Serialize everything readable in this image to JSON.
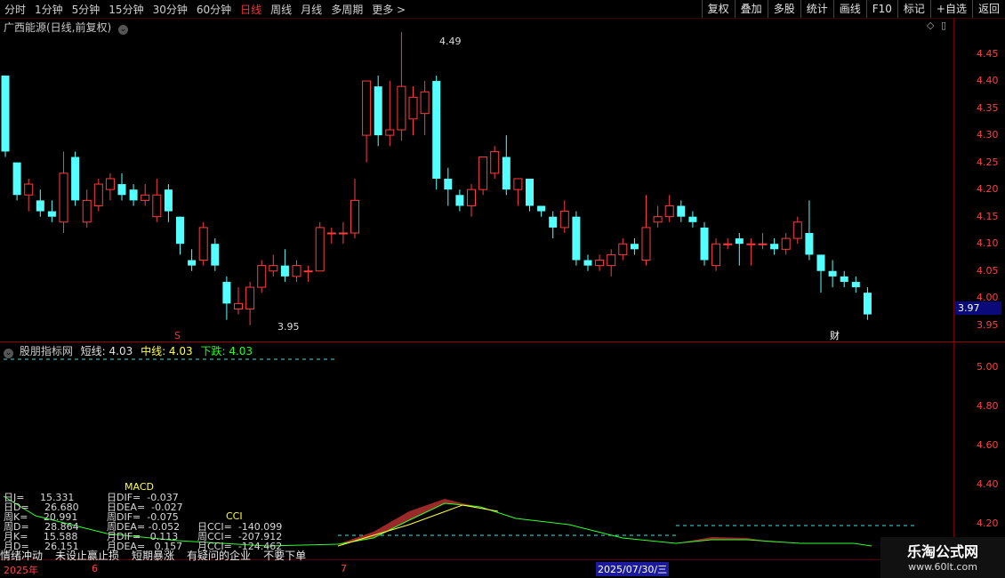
{
  "toolbar": {
    "tabs": [
      "分时",
      "1分钟",
      "5分钟",
      "15分钟",
      "30分钟",
      "60分钟",
      "日线",
      "周线",
      "月线",
      "多周期",
      "更多 >"
    ],
    "active_tab": "日线",
    "right_buttons": [
      "复权",
      "叠加",
      "多股",
      "统计",
      "画线",
      "F10",
      "标记",
      "+自选",
      "返回"
    ]
  },
  "stock": {
    "title": "广西能源(日线,前复权)",
    "last_price": "3.97",
    "high_label": "4.49",
    "low_label": "3.95",
    "marker_s": "S",
    "marker_cai": "财"
  },
  "price_axis": [
    "4.45",
    "4.40",
    "4.35",
    "4.30",
    "4.25",
    "4.20",
    "4.15",
    "4.10",
    "4.05",
    "4.00",
    "3.95"
  ],
  "indicator": {
    "name": "股朋指标网",
    "short_label": "短线: 4.03",
    "mid_label": "中线: 4.03",
    "down_label": "下跌: 4.03",
    "axis": [
      "5.00",
      "4.80",
      "4.60",
      "4.40",
      "4.20"
    ]
  },
  "stats": {
    "macd_title": "MACD",
    "cci_title": "CCI",
    "rows": [
      [
        "日J=     15.331",
        "日DIF=  -0.037"
      ],
      [
        "日D=     26.680",
        "日DEA=  -0.027"
      ],
      [
        "周K=     20.991",
        "周DIF=  -0.075"
      ],
      [
        "周D=     28.864",
        "周DEA= -0.052"
      ],
      [
        "月K=     15.588",
        "月DIF=   0.113"
      ],
      [
        "月D=     26.151",
        "月DEA=   0.157"
      ]
    ],
    "cci_rows": [
      "日CCI=  -140.099",
      "周CCI=  -207.912",
      "月CCI=  -124.462"
    ]
  },
  "status_items": [
    "情绪冲动",
    "未设止赢止损",
    "短期暴涨",
    "有疑问的企业",
    "不要下单"
  ],
  "dates": {
    "year": "2025年",
    "m6": "6",
    "m7": "7",
    "cursor": "2025/07/30/三"
  },
  "watermark": {
    "line1": "乐淘公式网",
    "line2": "www.60lt.com"
  },
  "colors": {
    "up": "#ff3c3c",
    "down": "#54ffff",
    "bg": "#000000",
    "axis": "#ff4040"
  },
  "chart_data": {
    "type": "candlestick",
    "ylim": [
      3.93,
      4.5
    ],
    "candles": [
      [
        4.41,
        4.27,
        4.41,
        4.26
      ],
      [
        4.25,
        4.19,
        4.25,
        4.18
      ],
      [
        4.19,
        4.21,
        4.22,
        4.16
      ],
      [
        4.18,
        4.16,
        4.2,
        4.15
      ],
      [
        4.16,
        4.15,
        4.18,
        4.14
      ],
      [
        4.14,
        4.23,
        4.27,
        4.12
      ],
      [
        4.26,
        4.18,
        4.27,
        4.17
      ],
      [
        4.14,
        4.18,
        4.2,
        4.13
      ],
      [
        4.17,
        4.21,
        4.22,
        4.16
      ],
      [
        4.2,
        4.22,
        4.23,
        4.18
      ],
      [
        4.21,
        4.19,
        4.23,
        4.18
      ],
      [
        4.2,
        4.18,
        4.21,
        4.17
      ],
      [
        4.18,
        4.19,
        4.21,
        4.17
      ],
      [
        4.15,
        4.19,
        4.22,
        4.14
      ],
      [
        4.2,
        4.16,
        4.21,
        4.14
      ],
      [
        4.15,
        4.1,
        4.15,
        4.08
      ],
      [
        4.07,
        4.06,
        4.09,
        4.05
      ],
      [
        4.07,
        4.13,
        4.14,
        4.06
      ],
      [
        4.1,
        4.06,
        4.11,
        4.05
      ],
      [
        4.03,
        3.99,
        4.04,
        3.96
      ],
      [
        3.98,
        3.99,
        4.02,
        3.97
      ],
      [
        3.98,
        4.02,
        4.03,
        3.95
      ],
      [
        4.02,
        4.06,
        4.07,
        4.01
      ],
      [
        4.05,
        4.06,
        4.08,
        4.04
      ],
      [
        4.06,
        4.04,
        4.09,
        4.03
      ],
      [
        4.04,
        4.06,
        4.07,
        4.03
      ],
      [
        4.05,
        4.05,
        4.06,
        4.03
      ],
      [
        4.05,
        4.13,
        4.14,
        4.05
      ],
      [
        4.12,
        4.12,
        4.13,
        4.1
      ],
      [
        4.12,
        4.12,
        4.14,
        4.1
      ],
      [
        4.12,
        4.18,
        4.22,
        4.11
      ],
      [
        4.3,
        4.4,
        4.4,
        4.25
      ],
      [
        4.39,
        4.3,
        4.41,
        4.28
      ],
      [
        4.3,
        4.31,
        4.4,
        4.28
      ],
      [
        4.31,
        4.39,
        4.49,
        4.29
      ],
      [
        4.33,
        4.37,
        4.39,
        4.3
      ],
      [
        4.34,
        4.38,
        4.4,
        4.3
      ],
      [
        4.4,
        4.22,
        4.41,
        4.2
      ],
      [
        4.22,
        4.2,
        4.24,
        4.17
      ],
      [
        4.19,
        4.17,
        4.2,
        4.16
      ],
      [
        4.17,
        4.2,
        4.21,
        4.15
      ],
      [
        4.2,
        4.26,
        4.26,
        4.19
      ],
      [
        4.23,
        4.27,
        4.28,
        4.22
      ],
      [
        4.26,
        4.2,
        4.3,
        4.19
      ],
      [
        4.2,
        4.22,
        4.22,
        4.17
      ],
      [
        4.22,
        4.17,
        4.22,
        4.16
      ],
      [
        4.17,
        4.16,
        4.17,
        4.15
      ],
      [
        4.15,
        4.13,
        4.16,
        4.11
      ],
      [
        4.13,
        4.16,
        4.18,
        4.12
      ],
      [
        4.15,
        4.07,
        4.16,
        4.06
      ],
      [
        4.07,
        4.06,
        4.08,
        4.05
      ],
      [
        4.06,
        4.07,
        4.08,
        4.05
      ],
      [
        4.06,
        4.08,
        4.09,
        4.04
      ],
      [
        4.08,
        4.1,
        4.11,
        4.07
      ],
      [
        4.1,
        4.09,
        4.11,
        4.08
      ],
      [
        4.07,
        4.13,
        4.19,
        4.06
      ],
      [
        4.14,
        4.15,
        4.17,
        4.13
      ],
      [
        4.15,
        4.17,
        4.19,
        4.14
      ],
      [
        4.17,
        4.15,
        4.18,
        4.14
      ],
      [
        4.15,
        4.14,
        4.16,
        4.13
      ],
      [
        4.13,
        4.07,
        4.14,
        4.06
      ],
      [
        4.06,
        4.1,
        4.11,
        4.05
      ],
      [
        4.1,
        4.1,
        4.11,
        4.09
      ],
      [
        4.11,
        4.1,
        4.12,
        4.06
      ],
      [
        4.1,
        4.1,
        4.11,
        4.06
      ],
      [
        4.1,
        4.1,
        4.12,
        4.09
      ],
      [
        4.1,
        4.09,
        4.11,
        4.08
      ],
      [
        4.09,
        4.11,
        4.12,
        4.08
      ],
      [
        4.11,
        4.14,
        4.15,
        4.1
      ],
      [
        4.12,
        4.08,
        4.18,
        4.07
      ],
      [
        4.08,
        4.05,
        4.08,
        4.01
      ],
      [
        4.05,
        4.04,
        4.07,
        4.02
      ],
      [
        4.04,
        4.03,
        4.05,
        4.02
      ],
      [
        4.03,
        4.02,
        4.04,
        4.01
      ],
      [
        4.01,
        3.97,
        4.02,
        3.96
      ]
    ]
  }
}
